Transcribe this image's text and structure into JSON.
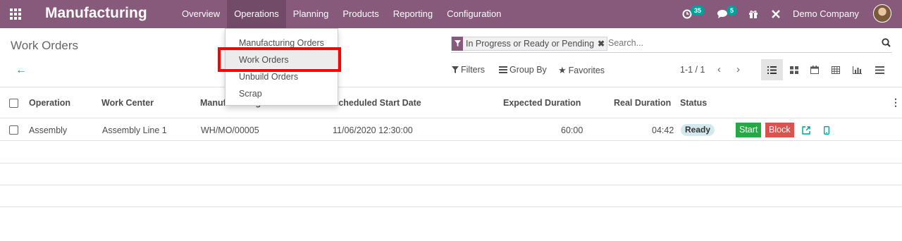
{
  "navbar": {
    "brand": "Manufacturing",
    "menu": [
      {
        "label": "Overview"
      },
      {
        "label": "Operations"
      },
      {
        "label": "Planning"
      },
      {
        "label": "Products"
      },
      {
        "label": "Reporting"
      },
      {
        "label": "Configuration"
      }
    ],
    "activity_count": "35",
    "messages_count": "5",
    "company": "Demo Company"
  },
  "operations_menu": {
    "items": [
      {
        "label": "Manufacturing Orders"
      },
      {
        "label": "Work Orders",
        "active": true
      },
      {
        "label": "Unbuild Orders"
      },
      {
        "label": "Scrap"
      }
    ]
  },
  "control_panel": {
    "title": "Work Orders",
    "facet": "In Progress or Ready or Pending",
    "search_placeholder": "Search...",
    "filters_label": "Filters",
    "group_by_label": "Group By",
    "favorites_label": "Favorites",
    "pager": "1-1 / 1",
    "views": [
      "list-view-icon",
      "kanban-view-icon",
      "calendar-view-icon",
      "pivot-view-icon",
      "graph-view-icon",
      "gantt-view-icon"
    ]
  },
  "table": {
    "columns": {
      "operation": "Operation",
      "work_center": "Work Center",
      "manufacturing_order": "Manufacturing Order",
      "scheduled_start": "Scheduled Start Date",
      "expected_duration": "Expected Duration",
      "real_duration": "Real Duration",
      "status": "Status"
    },
    "rows": [
      {
        "operation": "Assembly",
        "work_center": "Assembly Line 1",
        "manufacturing_order": "WH/MO/00005",
        "scheduled_start": "11/06/2020 12:30:00",
        "expected_duration": "60:00",
        "real_duration": "04:42",
        "status": "Ready",
        "start_label": "Start",
        "block_label": "Block"
      }
    ]
  },
  "colors": {
    "navbar": "#875a7b",
    "accent": "#00a09d",
    "start": "#28a745",
    "block": "#d9534f",
    "highlight": "#ff0000"
  }
}
